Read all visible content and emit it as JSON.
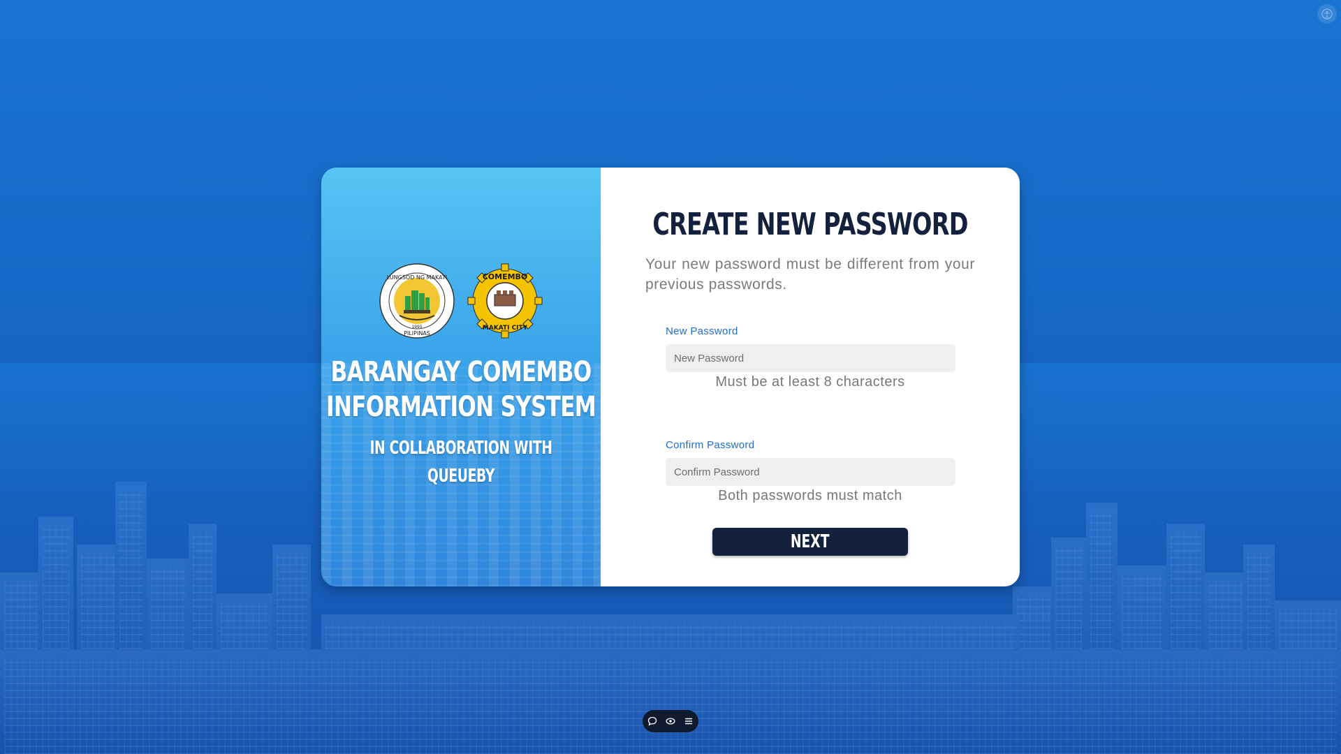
{
  "left_panel": {
    "seal_1_name": "lungsod-ng-makati-seal",
    "seal_1_text": "LUNGSOD NG MAKATI PILIPINAS 1995",
    "seal_2_name": "comembo-makati-city-seal",
    "seal_2_text": "COMEMBO MAKATI CITY",
    "title_line1": "BARANGAY COMEMBO",
    "title_line2": "INFORMATION SYSTEM",
    "subtitle_line1": "IN COLLABORATION WITH",
    "subtitle_line2": "QUEUEBY"
  },
  "form": {
    "title": "CREATE NEW PASSWORD",
    "description": "Your new password must be different from your previous passwords.",
    "new_password": {
      "label": "New Password",
      "placeholder": "New Password",
      "value": "",
      "hint": "Must be at least 8 characters"
    },
    "confirm_password": {
      "label": "Confirm Password",
      "placeholder": "Confirm Password",
      "value": "",
      "hint": "Both passwords must match"
    },
    "next_label": "NEXT"
  },
  "toolbar": {
    "icons": [
      "chat-icon",
      "eye-icon",
      "menu-icon"
    ]
  },
  "colors": {
    "background": "#1a74d2",
    "panel_gradient_top": "#56c4f3",
    "panel_gradient_bottom": "#2f86dc",
    "title_color": "#14213d",
    "label_color": "#1f6fc9",
    "button_color": "#14213d",
    "hint_color": "#777777"
  }
}
